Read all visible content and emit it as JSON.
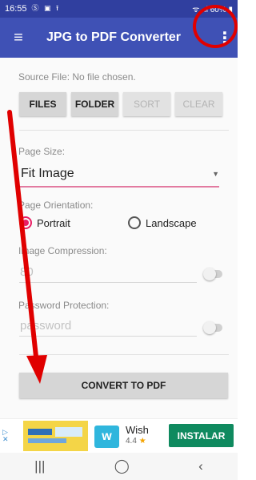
{
  "status_bar": {
    "time": "16:55",
    "icons": "Ⓢ ▣ ⭱",
    "right": "ᯤ .ıl 60% ▮"
  },
  "app_bar": {
    "title": "JPG to PDF Converter",
    "menu_icon": "hamburger-icon",
    "overflow_icon": "more-vert-icon"
  },
  "source": {
    "text": "Source File: No file chosen."
  },
  "buttons": {
    "files": "FILES",
    "folder": "FOLDER",
    "sort": "SORT",
    "clear": "CLEAR"
  },
  "page_size": {
    "label": "Page Size:",
    "value": "Fit Image"
  },
  "orientation": {
    "label": "Page Orientation:",
    "portrait": "Portrait",
    "landscape": "Landscape",
    "selected": "Portrait"
  },
  "compression": {
    "label": "Image Compression:",
    "value": "80",
    "enabled": false
  },
  "password": {
    "label": "Password Protection:",
    "placeholder": "password",
    "enabled": false
  },
  "convert": {
    "label": "CONVERT TO PDF"
  },
  "ad": {
    "choices": "▷\n✕",
    "app_name": "Wish",
    "rating": "4.4",
    "cta": "INSTALAR",
    "logo_letter": "w"
  },
  "nav": {
    "recents": "|||",
    "home": "◯",
    "back": "‹"
  },
  "colors": {
    "primary": "#3f51b5",
    "primary_dark": "#303f9f",
    "accent": "#e91e63",
    "annotation": "#e00000",
    "cta": "#0f8a5f"
  }
}
